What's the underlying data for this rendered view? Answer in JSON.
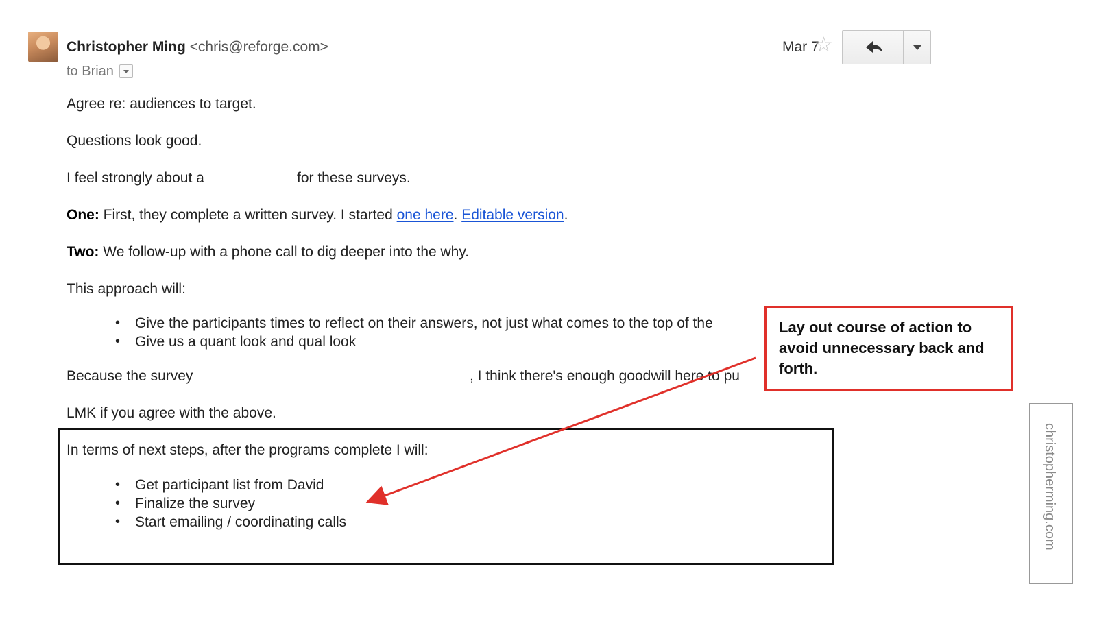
{
  "email": {
    "sender_name": "Christopher Ming",
    "sender_email": "<chris@reforge.com>",
    "to_line": "to Brian",
    "date": "Mar 7",
    "icons": {
      "star": "star-outline-icon",
      "reply": "reply-arrow-icon",
      "more": "chevron-down-icon",
      "to_details": "dropdown-caret-icon"
    }
  },
  "body": {
    "p1": "Agree re: audiences to target.",
    "p2": "Questions look good.",
    "p3_start": "I feel strongly about a",
    "p3_end": "for these surveys.",
    "p4_label": "One:",
    "p4_text": " First, they complete a written survey. I started ",
    "p4_link1": "one here",
    "p4_sep": ". ",
    "p4_link2": "Editable version",
    "p4_end": ".",
    "p5_label": "Two:",
    "p5_text": " We follow-up with a phone call to dig deeper into the why.",
    "p6": "This approach will:",
    "approach_bullets": [
      "Give the participants times to reflect on their answers, not just what comes to the top of the",
      "Give us a quant look and qual look"
    ],
    "p7_start": "Because the survey",
    "p7_end": ", I think there's enough goodwill here to pu",
    "p8": "LMK if you agree with the above.",
    "next_steps_intro": "In terms of next steps, after the programs complete I will:",
    "next_steps": [
      "Get participant list from David",
      "Finalize the survey",
      "Start emailing / coordinating calls"
    ]
  },
  "annotation": {
    "callout_text": "Lay out course of action to avoid unnecessary back and forth.",
    "box_color": "#e0302a",
    "arrow_color": "#e0302a"
  },
  "watermark": "christopherming.com"
}
